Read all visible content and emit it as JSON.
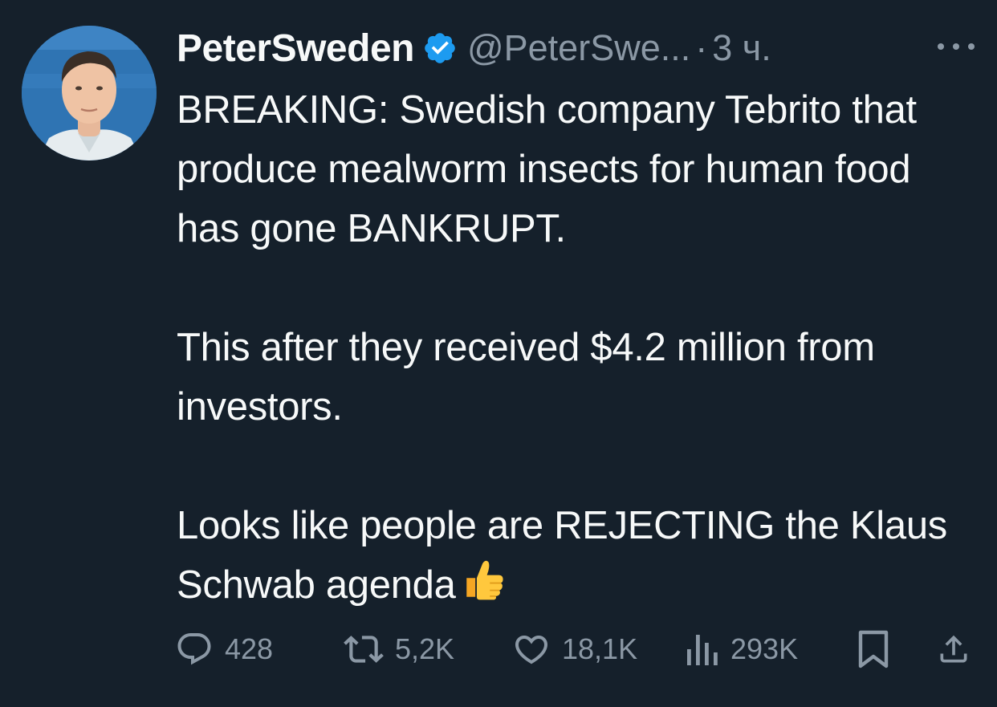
{
  "author": {
    "display_name": "PeterSweden",
    "handle": "@PeterSwe...",
    "separator": "·",
    "time": "3 ч.",
    "verified_icon": "verified-badge-icon",
    "accent_color": "#1d9bf0"
  },
  "tweet": {
    "paragraphs": [
      "BREAKING: Swedish company Tebrito that produce mealworm insects for human food has gone BANKRUPT.",
      "This after they received $4.2 million from investors.",
      "Looks like people are REJECTING the Klaus Schwab agenda"
    ],
    "emoji_icon": "thumbs-up-icon"
  },
  "actions": {
    "replies": "428",
    "reposts": "5,2K",
    "likes": "18,1K",
    "views": "293K"
  },
  "colors": {
    "background": "#15202b",
    "text": "#f7f9f9",
    "secondary_text": "#8b98a5"
  }
}
